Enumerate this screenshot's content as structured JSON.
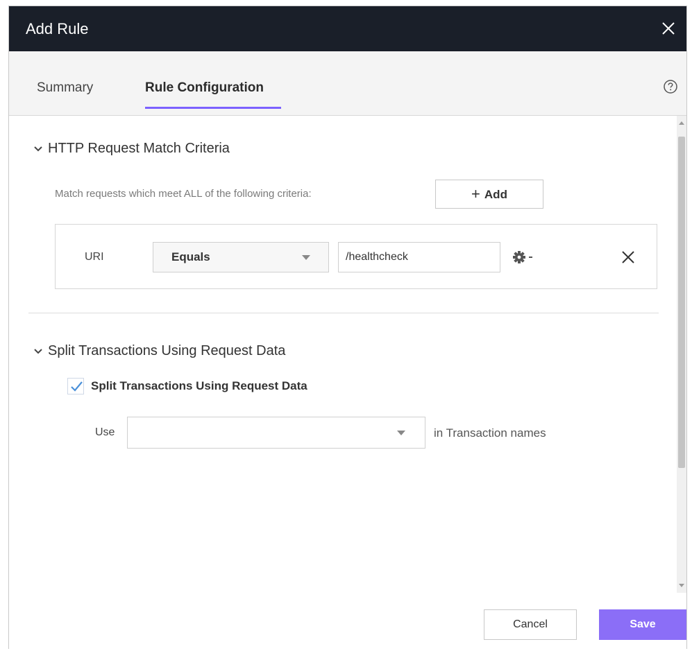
{
  "dialog": {
    "title": "Add Rule",
    "close_icon": "close-icon",
    "help_icon": "help-circle-icon"
  },
  "tabs": [
    {
      "label": "Summary",
      "active": false
    },
    {
      "label": "Rule Configuration",
      "active": true
    }
  ],
  "match_section": {
    "title": "HTTP Request Match Criteria",
    "expanded": true,
    "description": "Match requests which meet ALL of the following criteria:",
    "add_label": "Add",
    "criteria": [
      {
        "field": "URI",
        "operator": "Equals",
        "value": "/healthcheck",
        "options_icon": "gear-icon",
        "remove_icon": "close-icon"
      }
    ]
  },
  "split_section": {
    "title": "Split Transactions Using Request Data",
    "expanded": true,
    "checkbox_label": "Split Transactions Using Request Data",
    "checked": true,
    "use_label": "Use",
    "use_value": "",
    "suffix_label": "in Transaction names"
  },
  "footer": {
    "cancel_label": "Cancel",
    "save_label": "Save"
  },
  "colors": {
    "titlebar": "#1a1f29",
    "accent": "#7b61ff",
    "save_button": "#8b6ef7",
    "checkmark": "#4a90d9"
  }
}
